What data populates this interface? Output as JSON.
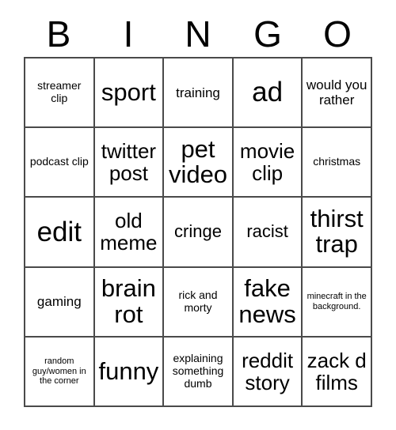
{
  "card": {
    "header": {
      "letters": [
        "B",
        "I",
        "N",
        "G",
        "O"
      ]
    },
    "grid": {
      "rows": 5,
      "columns": 5,
      "border_color": "#4a4a4a",
      "background_color": "#ffffff",
      "text_color": "#000000",
      "cells": [
        {
          "text": "streamer clip",
          "size": "s"
        },
        {
          "text": "sport",
          "size": "xxl"
        },
        {
          "text": "training",
          "size": "m"
        },
        {
          "text": "ad",
          "size": "huge"
        },
        {
          "text": "would you rather",
          "size": "m"
        },
        {
          "text": "podcast clip",
          "size": "s"
        },
        {
          "text": "twitter post",
          "size": "xl"
        },
        {
          "text": "pet video",
          "size": "xxl"
        },
        {
          "text": "movie clip",
          "size": "xl"
        },
        {
          "text": "christmas",
          "size": "s"
        },
        {
          "text": "edit",
          "size": "huge"
        },
        {
          "text": "old meme",
          "size": "xl"
        },
        {
          "text": "cringe",
          "size": "l"
        },
        {
          "text": "racist",
          "size": "l"
        },
        {
          "text": "thirst trap",
          "size": "xxl"
        },
        {
          "text": "gaming",
          "size": "m"
        },
        {
          "text": "brain rot",
          "size": "xxl"
        },
        {
          "text": "rick and morty",
          "size": "s"
        },
        {
          "text": "fake news",
          "size": "xxl"
        },
        {
          "text": "minecraft in the background.",
          "size": "xs"
        },
        {
          "text": "random guy/women in the corner",
          "size": "xs"
        },
        {
          "text": "funny",
          "size": "xxl"
        },
        {
          "text": "explaining something dumb",
          "size": "s"
        },
        {
          "text": "reddit story",
          "size": "xl"
        },
        {
          "text": "zack d films",
          "size": "xl"
        }
      ]
    }
  }
}
